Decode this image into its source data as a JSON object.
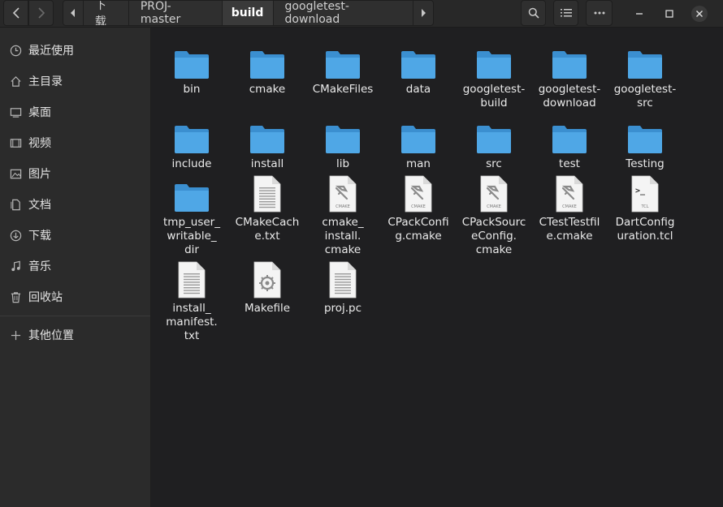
{
  "path": {
    "crumbs": [
      "下载",
      "PROJ-master",
      "build",
      "googletest-download"
    ],
    "active_index": 2
  },
  "sidebar": {
    "items": [
      {
        "label": "最近使用",
        "icon": "clock-icon"
      },
      {
        "label": "主目录",
        "icon": "home-icon"
      },
      {
        "label": "桌面",
        "icon": "desktop-icon"
      },
      {
        "label": "视频",
        "icon": "video-icon"
      },
      {
        "label": "图片",
        "icon": "picture-icon"
      },
      {
        "label": "文档",
        "icon": "document-icon"
      },
      {
        "label": "下载",
        "icon": "download-icon"
      },
      {
        "label": "音乐",
        "icon": "music-icon"
      },
      {
        "label": "回收站",
        "icon": "trash-icon"
      }
    ],
    "other": {
      "label": "其他位置",
      "icon": "plus-icon"
    }
  },
  "files": [
    {
      "name": "bin",
      "lines": [
        "bin"
      ],
      "type": "folder"
    },
    {
      "name": "cmake",
      "lines": [
        "cmake"
      ],
      "type": "folder"
    },
    {
      "name": "CMakeFiles",
      "lines": [
        "CMakeFiles"
      ],
      "type": "folder"
    },
    {
      "name": "data",
      "lines": [
        "data"
      ],
      "type": "folder"
    },
    {
      "name": "googletest-build",
      "lines": [
        "googletest-",
        "build"
      ],
      "type": "folder"
    },
    {
      "name": "googletest-download",
      "lines": [
        "googletest-",
        "download"
      ],
      "type": "folder"
    },
    {
      "name": "googletest-src",
      "lines": [
        "googletest-",
        "src"
      ],
      "type": "folder"
    },
    {
      "name": "include",
      "lines": [
        "include"
      ],
      "type": "folder"
    },
    {
      "name": "install",
      "lines": [
        "install"
      ],
      "type": "folder"
    },
    {
      "name": "lib",
      "lines": [
        "lib"
      ],
      "type": "folder"
    },
    {
      "name": "man",
      "lines": [
        "man"
      ],
      "type": "folder"
    },
    {
      "name": "src",
      "lines": [
        "src"
      ],
      "type": "folder"
    },
    {
      "name": "test",
      "lines": [
        "test"
      ],
      "type": "folder"
    },
    {
      "name": "Testing",
      "lines": [
        "Testing"
      ],
      "type": "folder"
    },
    {
      "name": "tmp_user_writable_dir",
      "lines": [
        "tmp_user_",
        "writable_",
        "dir"
      ],
      "type": "folder"
    },
    {
      "name": "CMakeCache.txt",
      "lines": [
        "CMakeCach",
        "e.txt"
      ],
      "type": "text"
    },
    {
      "name": "cmake_install.cmake",
      "lines": [
        "cmake_",
        "install.",
        "cmake"
      ],
      "type": "cmake"
    },
    {
      "name": "CPackConfig.cmake",
      "lines": [
        "CPackConfi",
        "g.cmake"
      ],
      "type": "cmake"
    },
    {
      "name": "CPackSourceConfig.cmake",
      "lines": [
        "CPackSourc",
        "eConfig.",
        "cmake"
      ],
      "type": "cmake"
    },
    {
      "name": "CTestTestfile.cmake",
      "lines": [
        "CTestTestfil",
        "e.cmake"
      ],
      "type": "cmake"
    },
    {
      "name": "DartConfiguration.tcl",
      "lines": [
        "DartConfig",
        "uration.tcl"
      ],
      "type": "tcl"
    },
    {
      "name": "install_manifest.txt",
      "lines": [
        "install_",
        "manifest.",
        "txt"
      ],
      "type": "text"
    },
    {
      "name": "Makefile",
      "lines": [
        "Makefile"
      ],
      "type": "makefile"
    },
    {
      "name": "proj.pc",
      "lines": [
        "proj.pc"
      ],
      "type": "text"
    }
  ],
  "icon_badges": {
    "cmake": "CMAKE",
    "tcl_prompt": ">_",
    "tcl": "TCL"
  },
  "colors": {
    "folder": "#4fa7e6",
    "folder_dark": "#3b8fd0",
    "background": "#1f1f21",
    "sidebar": "#2b2b2b"
  }
}
